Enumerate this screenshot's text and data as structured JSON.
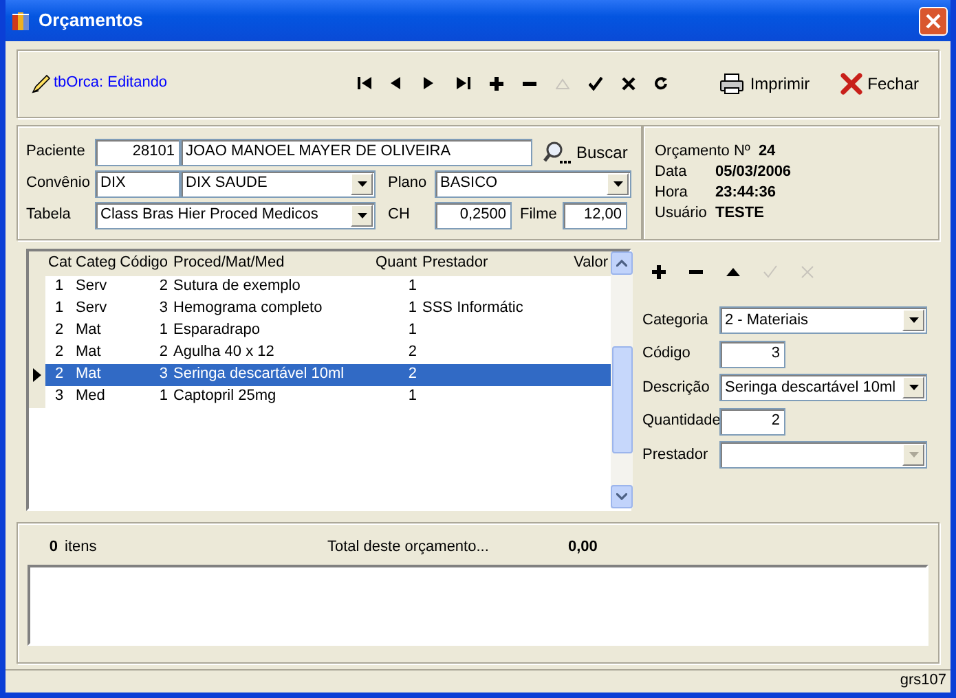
{
  "window": {
    "title": "Orçamentos"
  },
  "toolbar": {
    "status": "tbOrca: Editando",
    "nav": [
      {
        "kind": "first",
        "disabled": false
      },
      {
        "kind": "prev",
        "disabled": false
      },
      {
        "kind": "next",
        "disabled": false
      },
      {
        "kind": "last",
        "disabled": false
      },
      {
        "kind": "add",
        "disabled": false
      },
      {
        "kind": "remove",
        "disabled": false
      },
      {
        "kind": "up",
        "disabled": true
      },
      {
        "kind": "confirm",
        "disabled": false
      },
      {
        "kind": "cancel",
        "disabled": false
      },
      {
        "kind": "refresh",
        "disabled": false
      }
    ],
    "buttons": [
      {
        "kind": "print",
        "label": "Imprimir"
      },
      {
        "kind": "close",
        "label": "Fechar"
      }
    ]
  },
  "patient": {
    "paciente": {
      "label": "Paciente",
      "code": "28101",
      "name": "JOAO MANOEL MAYER DE OLIVEIRA"
    },
    "search_button": "Buscar",
    "convenio": {
      "label": "Convênio",
      "code": "DIX",
      "name": "DIX SAUDE"
    },
    "plano": {
      "label": "Plano",
      "value": "BASICO"
    },
    "tabela": {
      "label": "Tabela",
      "value": "Class Bras Hier Proced Medicos"
    },
    "ch": {
      "label": "CH",
      "value": "0,2500"
    },
    "filme": {
      "label": "Filme",
      "value": "12,00"
    }
  },
  "info": [
    {
      "label": "Orçamento Nº",
      "value": "24"
    },
    {
      "label": "Data",
      "value": "05/03/2006"
    },
    {
      "label": "Hora",
      "value": "23:44:36"
    },
    {
      "label": "Usuário",
      "value": "TESTE"
    }
  ],
  "table": {
    "columns": [
      "Cat",
      "Categ",
      "Código",
      "Proced/Mat/Med",
      "Quant",
      "Prestador",
      "Valor"
    ],
    "rows": [
      {
        "selected": false,
        "cells": [
          "1",
          "Serv",
          "2",
          "Sutura de exemplo",
          "1",
          ""
        ]
      },
      {
        "selected": false,
        "cells": [
          "1",
          "Serv",
          "3",
          "Hemograma completo",
          "1",
          "SSS Informátic"
        ]
      },
      {
        "selected": false,
        "cells": [
          "2",
          "Mat",
          "1",
          "Esparadrapo",
          "1",
          ""
        ]
      },
      {
        "selected": false,
        "cells": [
          "2",
          "Mat",
          "2",
          "Agulha 40 x 12",
          "2",
          ""
        ]
      },
      {
        "selected": true,
        "cells": [
          "2",
          "Mat",
          "3",
          "Seringa descartável 10ml",
          "2",
          ""
        ]
      },
      {
        "selected": false,
        "cells": [
          "3",
          "Med",
          "1",
          "Captopril 25mg",
          "1",
          ""
        ]
      }
    ]
  },
  "detail": {
    "tools": [
      {
        "kind": "add",
        "disabled": false
      },
      {
        "kind": "remove",
        "disabled": false
      },
      {
        "kind": "up",
        "disabled": false
      },
      {
        "kind": "confirm",
        "disabled": true
      },
      {
        "kind": "cancel",
        "disabled": true
      }
    ],
    "fields": [
      {
        "label": "Categoria",
        "kind": "combo",
        "value": "2 - Materiais",
        "disabled": false
      },
      {
        "label": "Código",
        "kind": "number",
        "value": "3",
        "disabled": false
      },
      {
        "label": "Descrição",
        "kind": "combo",
        "value": "Seringa descartável 10ml",
        "disabled": false
      },
      {
        "label": "Quantidade",
        "kind": "number",
        "value": "2",
        "disabled": false
      },
      {
        "label": "Prestador",
        "kind": "combo",
        "disabled": true
      }
    ]
  },
  "summary": {
    "count": "0",
    "count_label": "itens",
    "total_label": "Total deste orçamento...",
    "total": "0,00"
  },
  "status_bar": "grs107"
}
